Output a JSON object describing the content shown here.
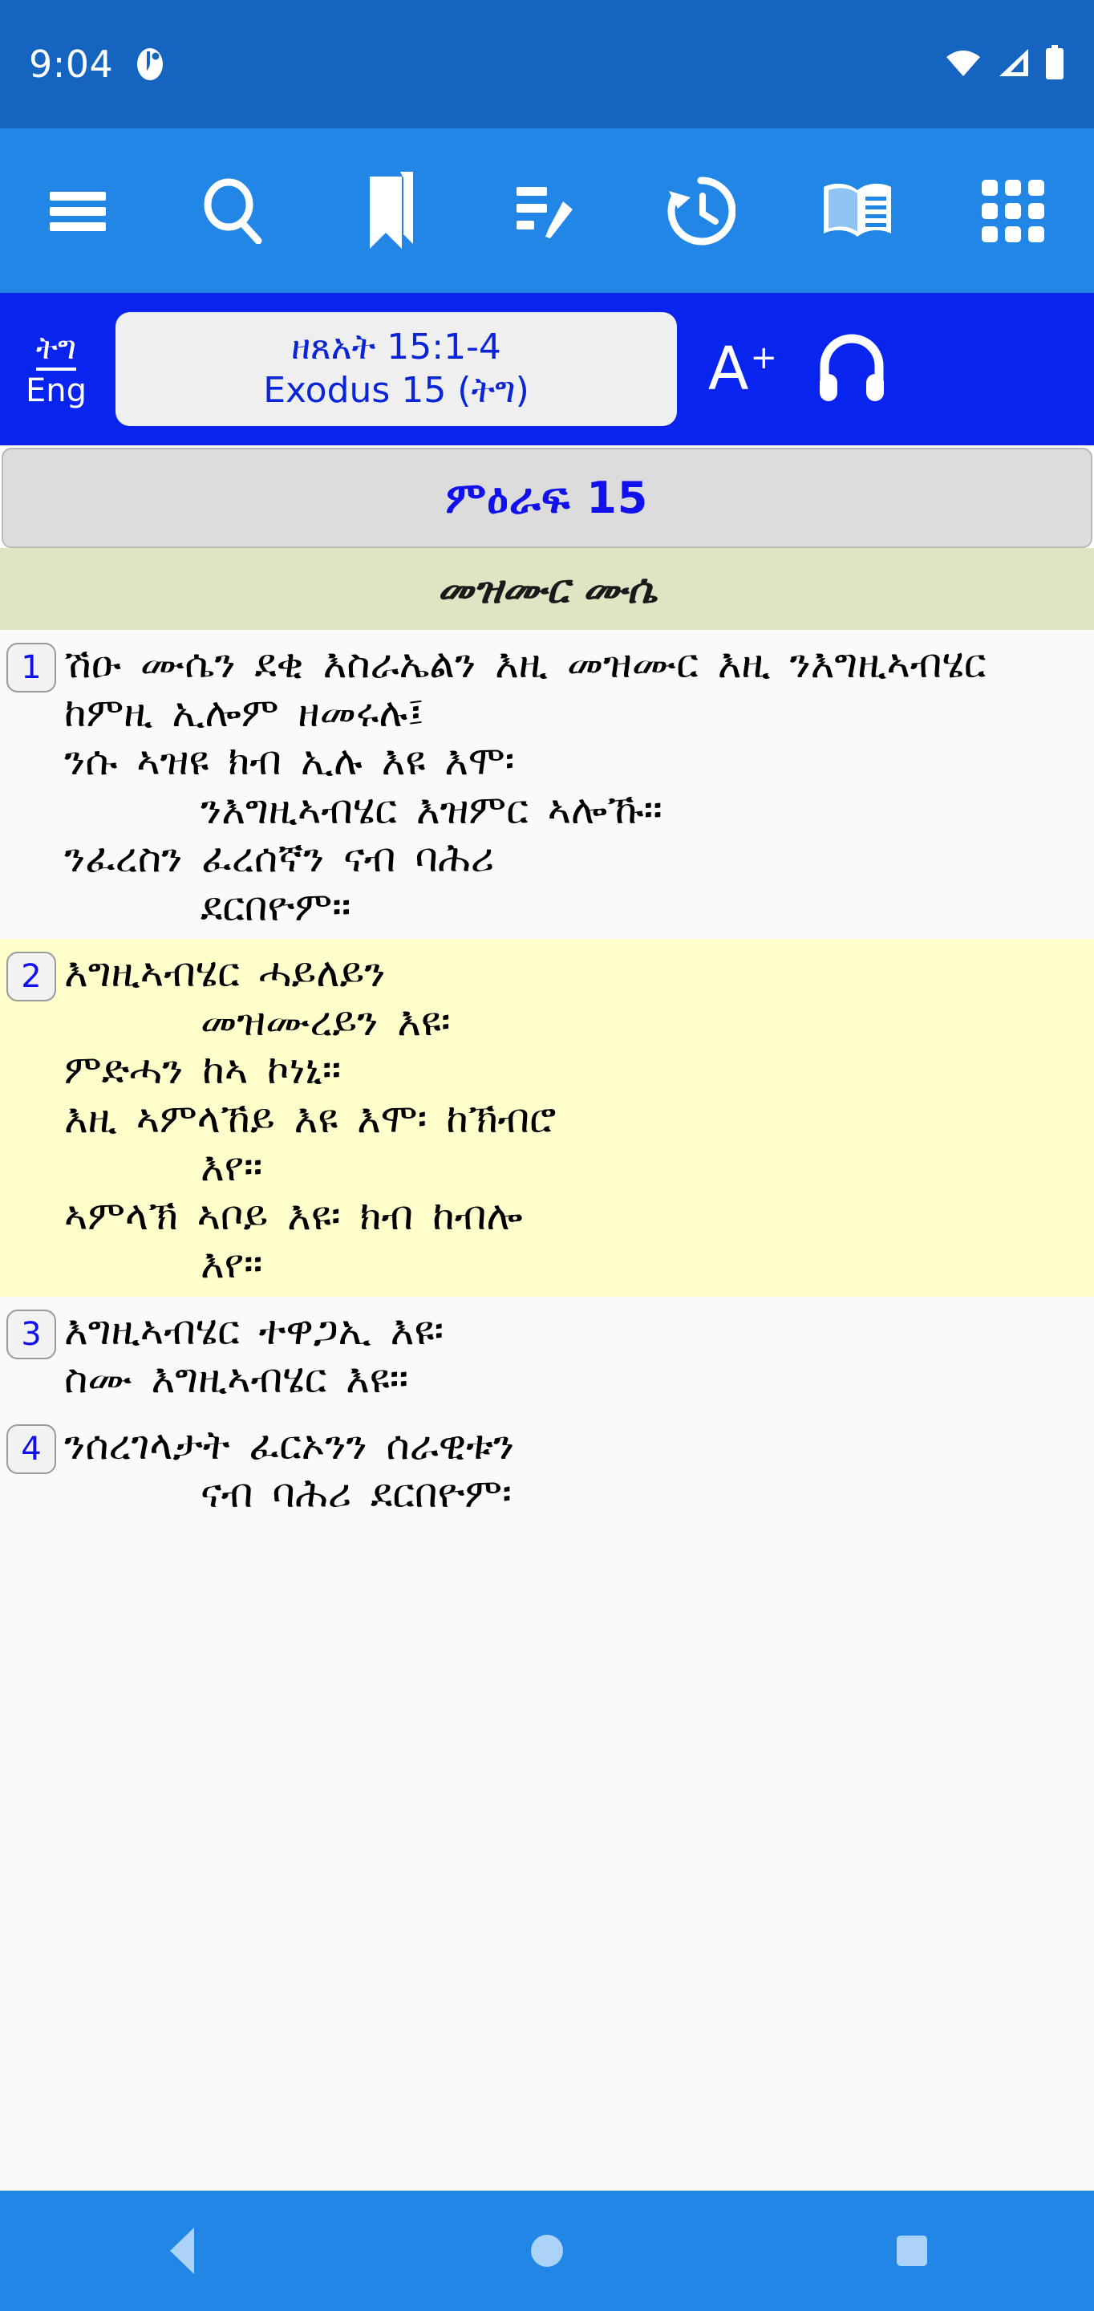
{
  "status_bar": {
    "time": "9:04",
    "app_icon": "bible-app-icon",
    "icons": [
      "wifi-icon",
      "cellular-signal-icon",
      "battery-icon"
    ]
  },
  "toolbar": {
    "items": [
      {
        "name": "menu-icon",
        "label": "Menu"
      },
      {
        "name": "search-icon",
        "label": "Search"
      },
      {
        "name": "bookmark-icon",
        "label": "Bookmarks"
      },
      {
        "name": "notes-icon",
        "label": "Notes"
      },
      {
        "name": "history-icon",
        "label": "History"
      },
      {
        "name": "book-icon",
        "label": "Read"
      },
      {
        "name": "grid-icon",
        "label": "Apps"
      }
    ]
  },
  "reference_bar": {
    "language_toggle_top": "ትግ",
    "language_toggle_bottom": "Eng",
    "reference_native": "ዘጸአት  15:1-4",
    "reference_english": "Exodus 15 (ትግ)",
    "font_size_letter": "A",
    "font_size_plus": "+",
    "audio_icon": "headphones-icon"
  },
  "chapter": {
    "title": "ምዕራፍ  15"
  },
  "section": {
    "title": "መዝሙር  ሙሴ"
  },
  "verses": [
    {
      "number": "1",
      "highlighted": false,
      "lines": [
        {
          "text": "ሽዑ ሙሴን ደቂ እስራኤልን እዚ መዝሙር እዚ ንእግዚኣብሄር ከምዚ ኢሎም ዘመሩሉ፤",
          "style": "normal"
        },
        {
          "text": "ንሱ ኣዝዩ ክብ ኢሉ እዩ እሞ፡",
          "style": "indent"
        },
        {
          "text": "ንእግዚኣብሄር እዝምር ኣሎኹ።",
          "style": "indent2"
        },
        {
          "text": "ንፈረስን ፈረሰኛን ናብ ባሕሪ",
          "style": "indent"
        },
        {
          "text": "ደርበዮም።",
          "style": "indent2"
        }
      ]
    },
    {
      "number": "2",
      "highlighted": true,
      "lines": [
        {
          "text": "እግዚኣብሄር ሓይለይን",
          "style": "indent"
        },
        {
          "text": "መዝሙረይን እዩ፡",
          "style": "indent2"
        },
        {
          "text": "ምድሓን ከኣ ኮነኒ።",
          "style": "indent"
        },
        {
          "text": "እዚ ኣምላኸይ እዩ እሞ፡ ከኽብሮ",
          "style": "indent"
        },
        {
          "text": "እየ።",
          "style": "indent2"
        },
        {
          "text": "ኣምላኽ ኣቦይ እዩ፡ ክብ ከብሎ",
          "style": "indent"
        },
        {
          "text": "እየ።",
          "style": "indent2"
        }
      ]
    },
    {
      "number": "3",
      "highlighted": false,
      "lines": [
        {
          "text": "እግዚኣብሄር ተዋጋኢ እዩ፡",
          "style": "indent"
        },
        {
          "text": "ስሙ እግዚኣብሄር እዩ።",
          "style": "indent"
        }
      ]
    },
    {
      "number": "4",
      "highlighted": false,
      "lines": [
        {
          "text": "ንሰረገላታት ፈርኦንን ሰራዊቱን",
          "style": "indent"
        },
        {
          "text": "ናብ ባሕሪ ደርበዮም፡",
          "style": "indent2"
        }
      ]
    }
  ],
  "nav_bar": {
    "back": "back-icon",
    "home": "home-icon",
    "recents": "recents-icon"
  },
  "colors": {
    "status_bar": "#1565C0",
    "toolbar": "#2186E5",
    "reference_bar": "#0A24F0",
    "chapter_bar": "#DCDCDC",
    "section_bar": "#DFE4C3",
    "highlight": "#FFFFCC",
    "accent_blue": "#1111EE",
    "nav_bar": "#2186E5"
  }
}
